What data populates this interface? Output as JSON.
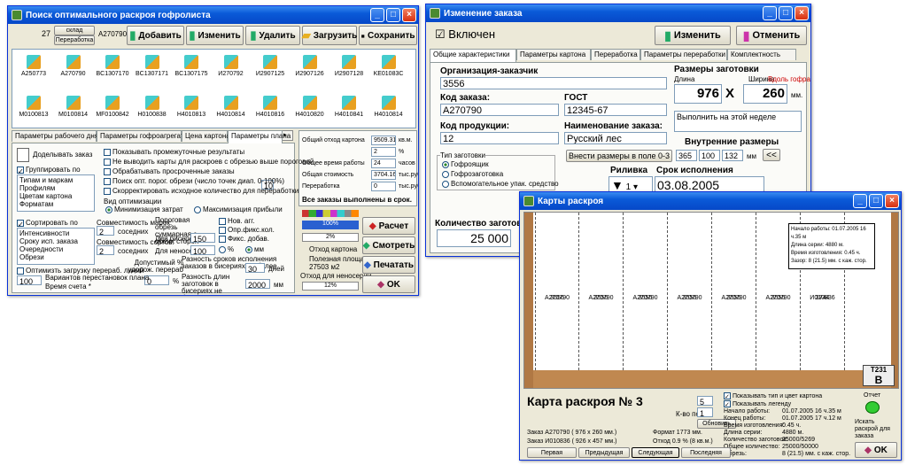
{
  "w1": {
    "title": "Поиск оптимального раскроя гофролиста",
    "num": "27",
    "sklad": "склад",
    "pererab": "Переработка",
    "code": "A270790",
    "btns": [
      "Добавить",
      "Изменить",
      "Удалить",
      "Загрузить",
      "Сохранить"
    ],
    "icons": [
      "A250773",
      "A270790",
      "BC1307170",
      "BC1307171",
      "BC1307175",
      "И270792",
      "И2907125",
      "И2907126",
      "И2907128",
      "KE01083C",
      "M0100813",
      "M0100814",
      "MF0100842",
      "H0100838",
      "H4010813",
      "H4010814",
      "H4010816",
      "H4010820",
      "H4010841",
      "H4010814"
    ],
    "tabs": [
      "Параметры рабочего дня",
      "Параметры гофроагрегата",
      "Цена картона",
      "Параметры плана"
    ],
    "dodel": "Доделывать заказ",
    "group": "Группировать по",
    "group_list": [
      "Типам и маркам",
      "Профилям",
      "Цветам картона",
      "Форматам"
    ],
    "checks": [
      "Показывать промежуточные результаты",
      "Не выводить карты для раскроев с обрезью выше пороговой",
      "Обрабатывать просроченные заказы",
      "Поиск опт. порог. обрези (число точек диап. 0-100%)",
      "Скорректировать исходное количество для переработки"
    ],
    "points": "10",
    "vid": "Вид оптимизации",
    "min": "Минимизация затрат",
    "max": "Максимизация прибыли",
    "sort": "Сортировать по",
    "sort_list": [
      "Интенсивности",
      "Сроку исп. заказа",
      "Очередности",
      "Обрези"
    ],
    "sovm": "Совместимость марок:",
    "sosed1": "соседних",
    "sosed_v1": "2",
    "sovm2": "Совместимость сортов:",
    "sosed_v2": "2",
    "porog": "Пороговая обрезь суммарная с обеих сторон",
    "bis": "Для бисерей",
    "bis_v": "150",
    "nonos": "Для неносерий",
    "nonos_v": "100",
    "nov": "Нов. агг.",
    "opr": "Опр.фикс.кол.",
    "fiks": "Фикс. добав.",
    "pct": "%",
    "mm": "мм",
    "dop": "Допустимый % удорож. перераб",
    "dop_v": "0",
    "raz": "Разность сроков исполнения заказов в бисериях не более",
    "raz_v": "30",
    "dn": "дней",
    "razd": "Разность длин заготовок в бисериях не более",
    "razd_v": "2000",
    "mm2": "мм",
    "optim": "Оптимизть загрузку перераб. линий",
    "var": "Вариантов перестановок плана",
    "var_v": "100",
    "vrem": "Время счета *",
    "vrem_v": "0",
    "stats": [
      {
        "l": "Общий отход картона",
        "v": "9509.31",
        "u": "кв.м."
      },
      {
        "l": "",
        "v": "2",
        "u": "%"
      },
      {
        "l": "Общее время работы",
        "v": "24",
        "u": "часов"
      },
      {
        "l": "Общая стоимость",
        "v": "3704.16",
        "u": "тыс.руб"
      },
      {
        "l": "Переработка",
        "v": "0",
        "u": "тыс.руб"
      }
    ],
    "done": "Все заказы выполнены в срок.",
    "p1": "100%",
    "p2": "2%",
    "otkhod": "Отход картона",
    "polezn": "Полезная площадь",
    "polezn_v": "27503 м2",
    "otkhnon": "Отход для неносерий",
    "p3": "12%",
    "rbtns": [
      "Расчет",
      "Смотреть",
      "Печатать",
      "OK"
    ]
  },
  "w2": {
    "title": "Изменение заказа",
    "vkl": "Включен",
    "izm": "Изменить",
    "otm": "Отменить",
    "tabs": [
      "Общие характеристики",
      "Параметры картона",
      "Переработка",
      "Параметры переработки",
      "Комплектность"
    ],
    "org_l": "Организация-заказчик",
    "org": "3556",
    "kod_l": "Код заказа:",
    "kod": "A270790",
    "gost_l": "ГОСТ",
    "gost": "12345-67",
    "prod_l": "Код продукции:",
    "prod": "12",
    "naim_l": "Наименование заказа:",
    "naim": "Русский лес",
    "razm": "Размеры заготовки",
    "dl": "Длина",
    "sh": "Ширина",
    "vdol": "Вдоль гофра",
    "dl_v": "976",
    "x": "X",
    "sh_v": "260",
    "mm": "мм.",
    "note": "Выполнить на этой неделе",
    "vn": "Внутренние размеры",
    "vnesti": "Внести размеры в поле 0-3",
    "vn1": "365",
    "vn2": "100",
    "vn3": "132",
    "vnmm": "мм",
    "back": "<<",
    "tip": "Тип заготовки",
    "t1": "Гофроящик",
    "t2": "Гофрозаготовка",
    "t3": "Вспомогательное упак. средство",
    "ril": "Риливка",
    "ril_v": "1",
    "srok": "Срок исполнения",
    "srok_v": "03.08.2005",
    "kol_l": "Количество заготовок",
    "kol": "25 000"
  },
  "w3": {
    "title": "Карты раскроя",
    "strips": [
      {
        "a": "A270790",
        "b": "3556"
      },
      {
        "a": "A270790",
        "b": "3556"
      },
      {
        "a": "A270790",
        "b": "3556"
      },
      {
        "a": "A270790",
        "b": "3556"
      },
      {
        "a": "A270790",
        "b": "3556"
      },
      {
        "a": "A270790",
        "b": "3556"
      },
      {
        "a": "И010836",
        "b": "3744"
      }
    ],
    "tip": [
      "Начало работы: 01.07.2005 16 ч.35 м",
      "Длина серии: 4880 м.",
      "Время изготовления: 0.45 ч.",
      "Зазор: 8 (21.5) мм. с каж. стор."
    ],
    "tag": "T231",
    "tagb": "B",
    "card": "Карта раскроя №  3",
    "kvo": "К-во пол.",
    "kvo1": "5",
    "kvo2": "1",
    "obn": "Обновить",
    "z1": "Заказ A270790 ( 976 x 260 мм.)",
    "z2": "Заказ И010836 ( 926 x 457 мм.)",
    "format": "Формат 1773 мм.",
    "otkhod": "Отход  0.9 % (8 кв.м.)",
    "chk1": "Показывать тип и цвет картона",
    "chk2": "Показывать легенду",
    "info": [
      [
        "Начало работы:",
        "01.07.2005 16 ч.35 м"
      ],
      [
        "Конец работы:",
        "01.07.2005 17 ч.12 м"
      ],
      [
        "Время изготовления:",
        "0.45 ч."
      ],
      [
        "Длина серии:",
        "4880 м."
      ],
      [
        "Количество заготовок:",
        "25000/5269"
      ],
      [
        "Общее количество:",
        "25000/50000"
      ],
      [
        "Обрезь:",
        "8 (21.5) мм. с каж. стор."
      ]
    ],
    "otchet": "Отчет",
    "iskat": "Искать раскрой для заказа",
    "nav": [
      "Первая",
      "Предыдущая",
      "Следующая",
      "Последняя"
    ],
    "ok": "OK"
  }
}
